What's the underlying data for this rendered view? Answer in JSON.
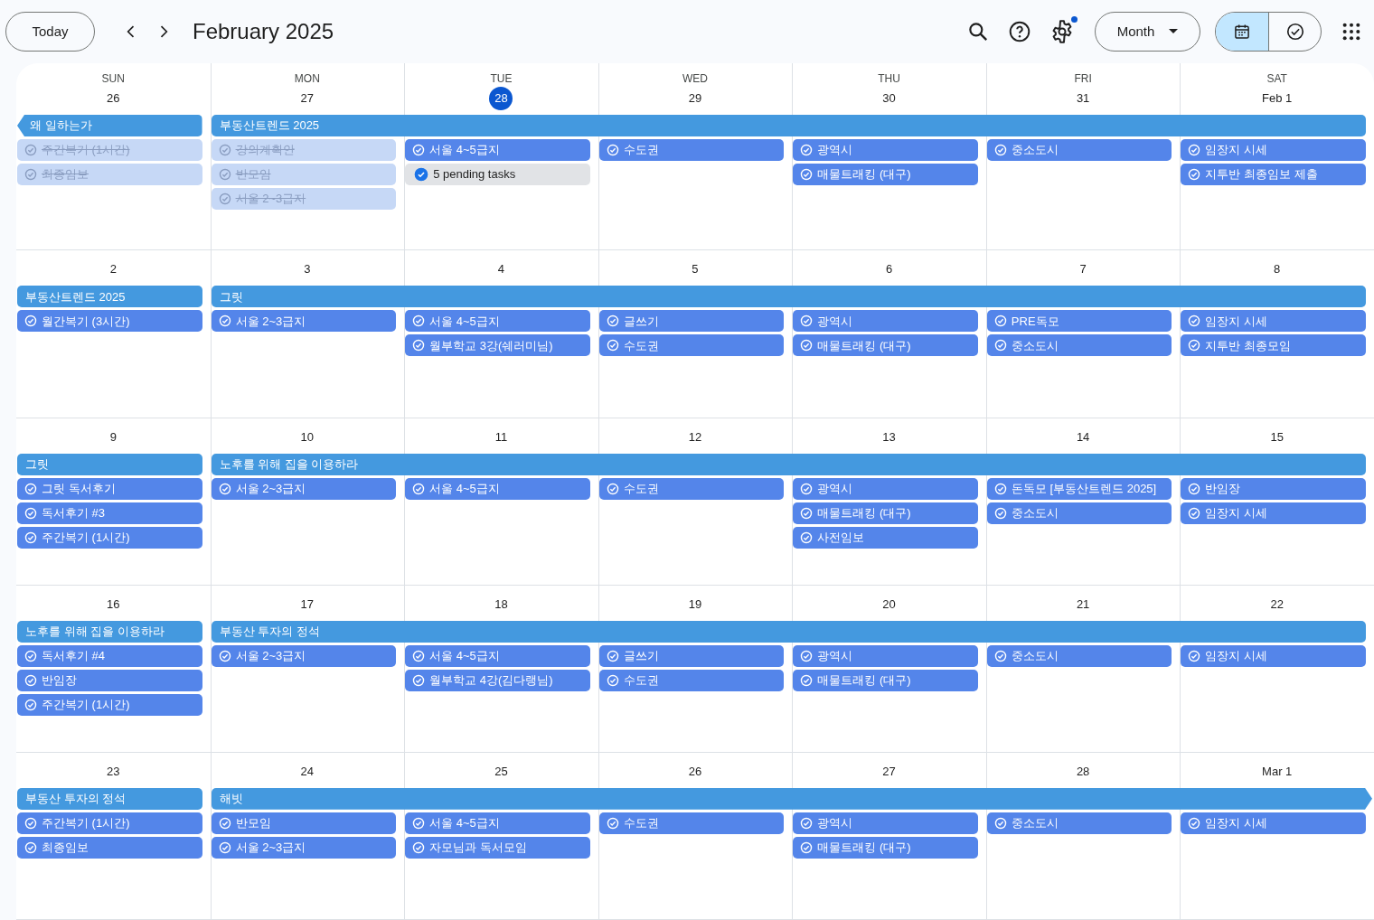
{
  "toolbar": {
    "today_button": "Today",
    "title": "February 2025",
    "settings_badge": true,
    "view_dropdown": "Month",
    "view_toggle": [
      {
        "kind": "calendar",
        "selected": true
      },
      {
        "kind": "tasks",
        "selected": false
      }
    ]
  },
  "weeks": [
    {
      "days": [
        {
          "weekday": "SUN",
          "label": "26",
          "today": false,
          "banner": {
            "title": "왜 일하는가",
            "continues_before": true,
            "continues_after": false
          },
          "tasks": [
            {
              "kind": "task",
              "title": "주간복기 (1시간)",
              "done": true
            },
            {
              "kind": "task",
              "title": "최종임보",
              "done": true
            }
          ]
        },
        {
          "weekday": "MON",
          "label": "27",
          "today": false,
          "banner": {
            "title": "부동산트렌드 2025",
            "continues_before": false,
            "continues_after": false
          },
          "tasks": [
            {
              "kind": "task",
              "title": "강의계획안",
              "done": true
            },
            {
              "kind": "task",
              "title": "반모임",
              "done": true
            },
            {
              "kind": "task",
              "title": "서울 2~3급지",
              "done": true
            }
          ]
        },
        {
          "weekday": "TUE",
          "label": "28",
          "today": true,
          "tasks": [
            {
              "kind": "task",
              "title": "서울 4~5급지",
              "done": false
            },
            {
              "kind": "pending",
              "title": "5 pending tasks"
            }
          ]
        },
        {
          "weekday": "WED",
          "label": "29",
          "today": false,
          "tasks": [
            {
              "kind": "task",
              "title": "수도권",
              "done": false
            }
          ]
        },
        {
          "weekday": "THU",
          "label": "30",
          "today": false,
          "tasks": [
            {
              "kind": "task",
              "title": "광역시",
              "done": false
            },
            {
              "kind": "task",
              "title": "매물트래킹 (대구)",
              "done": false
            }
          ]
        },
        {
          "weekday": "FRI",
          "label": "31",
          "today": false,
          "tasks": [
            {
              "kind": "task",
              "title": "중소도시",
              "done": false
            }
          ]
        },
        {
          "weekday": "SAT",
          "label": "Feb 1",
          "today": false,
          "tasks": [
            {
              "kind": "task",
              "title": "임장지 시세",
              "done": false
            },
            {
              "kind": "task",
              "title": "지투반 최종임보 제출",
              "done": false
            }
          ]
        }
      ]
    },
    {
      "days": [
        {
          "label": "2",
          "today": false,
          "banner": {
            "title": "부동산트렌드 2025",
            "continues_before": false,
            "continues_after": false
          },
          "tasks": [
            {
              "kind": "task",
              "title": "월간복기 (3시간)",
              "done": false
            }
          ]
        },
        {
          "label": "3",
          "today": false,
          "banner": {
            "title": "그릿",
            "continues_before": false,
            "continues_after": false
          },
          "tasks": [
            {
              "kind": "task",
              "title": "서울 2~3급지",
              "done": false
            }
          ]
        },
        {
          "label": "4",
          "today": false,
          "tasks": [
            {
              "kind": "task",
              "title": "서울 4~5급지",
              "done": false
            },
            {
              "kind": "task",
              "title": "월부학교 3강(쉐러미님)",
              "done": false
            }
          ]
        },
        {
          "label": "5",
          "today": false,
          "tasks": [
            {
              "kind": "task",
              "title": "글쓰기",
              "done": false
            },
            {
              "kind": "task",
              "title": "수도권",
              "done": false
            }
          ]
        },
        {
          "label": "6",
          "today": false,
          "tasks": [
            {
              "kind": "task",
              "title": "광역시",
              "done": false
            },
            {
              "kind": "task",
              "title": "매물트래킹 (대구)",
              "done": false
            }
          ]
        },
        {
          "label": "7",
          "today": false,
          "tasks": [
            {
              "kind": "task",
              "title": "PRE독모",
              "done": false
            },
            {
              "kind": "task",
              "title": "중소도시",
              "done": false
            }
          ]
        },
        {
          "label": "8",
          "today": false,
          "tasks": [
            {
              "kind": "task",
              "title": "임장지 시세",
              "done": false
            },
            {
              "kind": "task",
              "title": "지투반 최종모임",
              "done": false
            }
          ]
        }
      ]
    },
    {
      "days": [
        {
          "label": "9",
          "today": false,
          "banner": {
            "title": "그릿",
            "continues_before": false,
            "continues_after": false
          },
          "tasks": [
            {
              "kind": "task",
              "title": "그릿 독서후기",
              "done": false
            },
            {
              "kind": "task",
              "title": "독서후기 #3",
              "done": false
            },
            {
              "kind": "task",
              "title": "주간복기 (1시간)",
              "done": false
            }
          ]
        },
        {
          "label": "10",
          "today": false,
          "banner": {
            "title": "노후를 위해 집을 이용하라",
            "continues_before": false,
            "continues_after": false
          },
          "tasks": [
            {
              "kind": "task",
              "title": "서울 2~3급지",
              "done": false
            }
          ]
        },
        {
          "label": "11",
          "today": false,
          "tasks": [
            {
              "kind": "task",
              "title": "서울 4~5급지",
              "done": false
            }
          ]
        },
        {
          "label": "12",
          "today": false,
          "tasks": [
            {
              "kind": "task",
              "title": "수도권",
              "done": false
            }
          ]
        },
        {
          "label": "13",
          "today": false,
          "tasks": [
            {
              "kind": "task",
              "title": "광역시",
              "done": false
            },
            {
              "kind": "task",
              "title": "매물트래킹 (대구)",
              "done": false
            },
            {
              "kind": "task",
              "title": "사전임보",
              "done": false
            }
          ]
        },
        {
          "label": "14",
          "today": false,
          "tasks": [
            {
              "kind": "task",
              "title": "돈독모 [부동산트렌드 2025]",
              "done": false
            },
            {
              "kind": "task",
              "title": "중소도시",
              "done": false
            }
          ]
        },
        {
          "label": "15",
          "today": false,
          "tasks": [
            {
              "kind": "task",
              "title": "반임장",
              "done": false
            },
            {
              "kind": "task",
              "title": "임장지 시세",
              "done": false
            }
          ]
        }
      ]
    },
    {
      "days": [
        {
          "label": "16",
          "today": false,
          "banner": {
            "title": "노후를 위해 집을 이용하라",
            "continues_before": false,
            "continues_after": false
          },
          "tasks": [
            {
              "kind": "task",
              "title": "독서후기 #4",
              "done": false
            },
            {
              "kind": "task",
              "title": "반임장",
              "done": false
            },
            {
              "kind": "task",
              "title": "주간복기 (1시간)",
              "done": false
            }
          ]
        },
        {
          "label": "17",
          "today": false,
          "banner": {
            "title": "부동산 투자의 정석",
            "continues_before": false,
            "continues_after": false
          },
          "tasks": [
            {
              "kind": "task",
              "title": "서울 2~3급지",
              "done": false
            }
          ]
        },
        {
          "label": "18",
          "today": false,
          "tasks": [
            {
              "kind": "task",
              "title": "서울 4~5급지",
              "done": false
            },
            {
              "kind": "task",
              "title": "월부학교 4강(김다랭님)",
              "done": false
            }
          ]
        },
        {
          "label": "19",
          "today": false,
          "tasks": [
            {
              "kind": "task",
              "title": "글쓰기",
              "done": false
            },
            {
              "kind": "task",
              "title": "수도권",
              "done": false
            }
          ]
        },
        {
          "label": "20",
          "today": false,
          "tasks": [
            {
              "kind": "task",
              "title": "광역시",
              "done": false
            },
            {
              "kind": "task",
              "title": "매물트래킹 (대구)",
              "done": false
            }
          ]
        },
        {
          "label": "21",
          "today": false,
          "tasks": [
            {
              "kind": "task",
              "title": "중소도시",
              "done": false
            }
          ]
        },
        {
          "label": "22",
          "today": false,
          "tasks": [
            {
              "kind": "task",
              "title": "임장지 시세",
              "done": false
            }
          ]
        }
      ]
    },
    {
      "days": [
        {
          "label": "23",
          "today": false,
          "banner": {
            "title": "부동산 투자의 정석",
            "continues_before": false,
            "continues_after": false
          },
          "tasks": [
            {
              "kind": "task",
              "title": "주간복기 (1시간)",
              "done": false
            },
            {
              "kind": "task",
              "title": "최종임보",
              "done": false
            }
          ]
        },
        {
          "label": "24",
          "today": false,
          "banner": {
            "title": "해빗",
            "continues_before": false,
            "continues_after": true
          },
          "tasks": [
            {
              "kind": "task",
              "title": "반모임",
              "done": false
            },
            {
              "kind": "task",
              "title": "서울 2~3급지",
              "done": false
            }
          ]
        },
        {
          "label": "25",
          "today": false,
          "tasks": [
            {
              "kind": "task",
              "title": "서울 4~5급지",
              "done": false
            },
            {
              "kind": "task",
              "title": "자모님과 독서모임",
              "done": false
            }
          ]
        },
        {
          "label": "26",
          "today": false,
          "tasks": [
            {
              "kind": "task",
              "title": "수도권",
              "done": false
            }
          ]
        },
        {
          "label": "27",
          "today": false,
          "tasks": [
            {
              "kind": "task",
              "title": "광역시",
              "done": false
            },
            {
              "kind": "task",
              "title": "매물트래킹 (대구)",
              "done": false
            }
          ]
        },
        {
          "label": "28",
          "today": false,
          "tasks": [
            {
              "kind": "task",
              "title": "중소도시",
              "done": false
            }
          ]
        },
        {
          "label": "Mar 1",
          "today": false,
          "tasks": [
            {
              "kind": "task",
              "title": "임장지 시세",
              "done": false
            }
          ]
        }
      ]
    }
  ]
}
